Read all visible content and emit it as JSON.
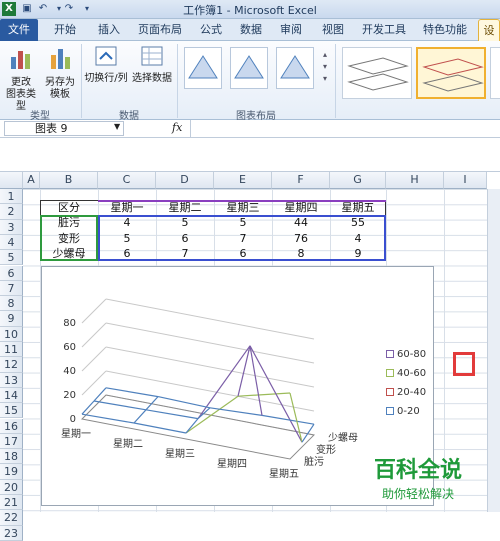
{
  "window": {
    "title": "工作簿1 - Microsoft Excel",
    "app_icon": "X"
  },
  "quick_access": [
    "save-icon",
    "undo-icon",
    "redo-icon",
    "customize-icon"
  ],
  "tabs": [
    {
      "label": "文件"
    },
    {
      "label": "开始"
    },
    {
      "label": "插入"
    },
    {
      "label": "页面布局"
    },
    {
      "label": "公式"
    },
    {
      "label": "数据"
    },
    {
      "label": "审阅"
    },
    {
      "label": "视图"
    },
    {
      "label": "开发工具"
    },
    {
      "label": "特色功能"
    },
    {
      "label": "设"
    }
  ],
  "ribbon": {
    "type_group": {
      "label": "类型",
      "change_type": "更改\n图表类型",
      "save_template": "另存为\n模板"
    },
    "data_group": {
      "label": "数据",
      "switch_row_col": "切换行/列",
      "select_data": "选择数据"
    },
    "layout_group": {
      "label": "图表布局"
    }
  },
  "formula_bar": {
    "name_box": "图表 9",
    "fx": "fx",
    "formula": ""
  },
  "columns": [
    "A",
    "B",
    "C",
    "D",
    "E",
    "F",
    "G",
    "H",
    "I"
  ],
  "rows": [
    "1",
    "2",
    "3",
    "4",
    "5",
    "6",
    "7",
    "8",
    "9",
    "10",
    "11",
    "12",
    "13",
    "14",
    "15",
    "16",
    "17",
    "18",
    "19",
    "20",
    "21",
    "22",
    "23"
  ],
  "table": {
    "headers": [
      "区分",
      "星期一",
      "星期二",
      "星期三",
      "星期四",
      "星期五"
    ],
    "rows": [
      [
        "脏污",
        "4",
        "5",
        "5",
        "44",
        "55"
      ],
      [
        "变形",
        "5",
        "6",
        "7",
        "76",
        "4"
      ],
      [
        "少螺母",
        "6",
        "7",
        "6",
        "8",
        "9"
      ]
    ]
  },
  "chart_data": {
    "type": "surface",
    "categories": [
      "星期一",
      "星期二",
      "星期三",
      "星期四",
      "星期五"
    ],
    "series": [
      {
        "name": "脏污",
        "values": [
          4,
          5,
          5,
          44,
          55
        ]
      },
      {
        "name": "变形",
        "values": [
          5,
          6,
          7,
          76,
          4
        ]
      },
      {
        "name": "少螺母",
        "values": [
          6,
          7,
          6,
          8,
          9
        ]
      }
    ],
    "z_ticks": [
      "0",
      "20",
      "40",
      "60",
      "80"
    ],
    "x_tick_labels": [
      "星期一",
      "星期二",
      "星期三",
      "星期四",
      "星期五"
    ],
    "depth_labels": [
      "少螺母",
      "变形",
      "脏污"
    ],
    "legend": [
      {
        "label": "60-80",
        "color": "#7b5ea7"
      },
      {
        "label": "40-60",
        "color": "#9bbb59"
      },
      {
        "label": "20-40",
        "color": "#c0504d"
      },
      {
        "label": "0-20",
        "color": "#4f81bd"
      }
    ],
    "legend_position": "right"
  },
  "watermark": {
    "main": "百科全说",
    "sub": "助你轻松解决"
  }
}
